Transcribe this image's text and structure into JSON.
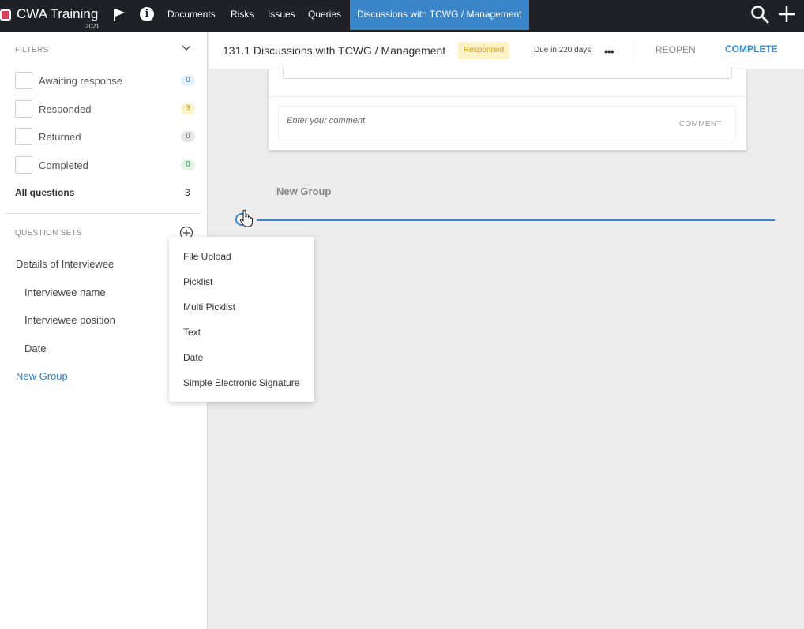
{
  "topbar": {
    "app_title": "CWA Training",
    "app_year": "2021",
    "tabs": [
      {
        "label": "Documents"
      },
      {
        "label": "Risks"
      },
      {
        "label": "Issues"
      },
      {
        "label": "Queries"
      },
      {
        "label": "Discussions with TCWG / Management"
      }
    ],
    "logo_color": "#d9415b",
    "active_tab_color": "#3a85c8"
  },
  "sidebar": {
    "filters_label": "FILTERS",
    "filters": [
      {
        "label": "Awaiting response",
        "count": "0",
        "badge": "blue"
      },
      {
        "label": "Responded",
        "count": "3",
        "badge": "yellow"
      },
      {
        "label": "Returned",
        "count": "0",
        "badge": "grey"
      },
      {
        "label": "Completed",
        "count": "0",
        "badge": "green"
      }
    ],
    "all_questions_label": "All questions",
    "all_questions_count": "3",
    "question_sets_label": "QUESTION SETS",
    "question_sets": [
      {
        "label": "Details of Interviewee"
      },
      {
        "label": "Interviewee name"
      },
      {
        "label": "Interviewee position"
      },
      {
        "label": "Date"
      },
      {
        "label": "New Group"
      }
    ]
  },
  "header": {
    "title": "131.1 Discussions with TCWG / Management",
    "status": "Responded",
    "due": "Due in 220 days",
    "more": "•••",
    "reopen_label": "REOPEN",
    "complete_label": "COMPLETE"
  },
  "card": {
    "comment_placeholder": "Enter your comment",
    "comment_button": "COMMENT"
  },
  "group": {
    "title": "New Group"
  },
  "add_question_menu": {
    "items": [
      {
        "label": "File Upload"
      },
      {
        "label": "Picklist"
      },
      {
        "label": "Multi Picklist"
      },
      {
        "label": "Text"
      },
      {
        "label": "Date"
      },
      {
        "label": "Simple Electronic Signature"
      }
    ]
  }
}
